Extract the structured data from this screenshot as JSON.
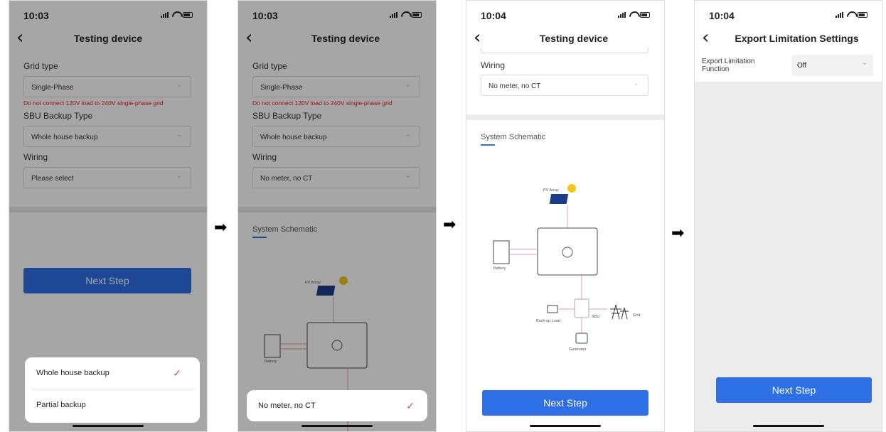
{
  "screens": [
    {
      "time": "10:03",
      "title": "Testing device",
      "grid_label": "Grid type",
      "grid_value": "Single-Phase",
      "warning": "Do not connect 120V load to 240V single-phase grid",
      "sbu_label": "SBU Backup Type",
      "sbu_value": "Whole house backup",
      "wiring_label": "Wiring",
      "wiring_value": "Please select",
      "next_label": "Next Step",
      "sheet_options": [
        "Whole house backup",
        "Partial backup"
      ]
    },
    {
      "time": "10:03",
      "title": "Testing device",
      "grid_label": "Grid type",
      "grid_value": "Single-Phase",
      "warning": "Do not connect 120V load to 240V single-phase grid",
      "sbu_label": "SBU Backup Type",
      "sbu_value": "Whole house backup",
      "wiring_label": "Wiring",
      "wiring_value": "No meter, no CT",
      "schematic_title": "System Schematic",
      "sheet_options": [
        "No meter, no CT"
      ],
      "pv_label": "PV Array",
      "battery_label": "Battery"
    },
    {
      "time": "10:04",
      "title": "Testing device",
      "wiring_label": "Wiring",
      "wiring_value": "No meter, no CT",
      "schematic_title": "System Schematic",
      "pv_label": "PV Array",
      "battery_label": "Battery",
      "backup_label": "Back-up Load",
      "sbu_label": "SBU",
      "grid_label": "Grid",
      "generator_label": "Generator",
      "next_label": "Next Step"
    },
    {
      "time": "10:04",
      "title": "Export Limitation Settings",
      "export_label": "Export Limitation Function",
      "export_value": "Off",
      "next_label": "Next Step"
    }
  ],
  "arrow_glyph": "➡",
  "colors": {
    "accent": "#2f6fe6",
    "warning": "#e02020",
    "check": "#e05050"
  }
}
